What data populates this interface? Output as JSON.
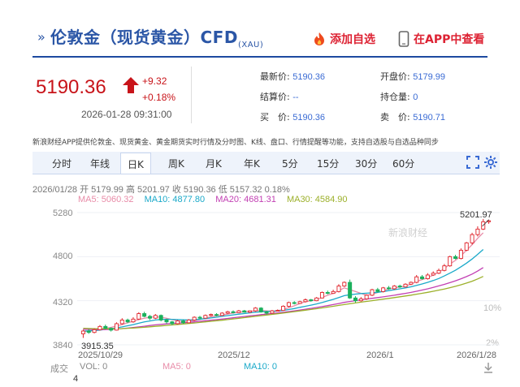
{
  "header": {
    "arrow": "»",
    "title": "伦敦金（现货黄金）CFD",
    "symbol": "(XAU)",
    "add_favorite": "添加自选",
    "view_in_app": "在APP中查看"
  },
  "quote": {
    "price": "5190.36",
    "change": "+9.32",
    "change_pct": "+0.18%",
    "time": "2026-01-28 09:31:00",
    "latest_label": "最新价:",
    "latest_value": "5190.36",
    "open_label": "开盘价:",
    "open_value": "5179.99",
    "settle_label": "结算价:",
    "settle_value": "--",
    "hold_label": "持仓量:",
    "hold_value": "0",
    "buy_label": "买　价:",
    "buy_value": "5190.36",
    "sell_label": "卖　价:",
    "sell_value": "5190.71",
    "up_color": "#c8141a",
    "value_color": "#3a6bd4"
  },
  "note": "新浪财经APP提供伦敦金、现货黄金、黄金期货实时行情及分时图、K线、盘口、行情提醒等功能，支持自选股与自选品种同步",
  "tabs": [
    {
      "label": "分时"
    },
    {
      "label": "年线"
    },
    {
      "label": "日K",
      "active": true
    },
    {
      "label": "周K"
    },
    {
      "label": "月K"
    },
    {
      "label": "年K"
    },
    {
      "label": "5分"
    },
    {
      "label": "15分"
    },
    {
      "label": "30分"
    },
    {
      "label": "60分"
    }
  ],
  "tab_icons": [
    "expand-icon",
    "settings-icon"
  ],
  "chart_info": {
    "line1": "2026/01/28 开 5179.99 高 5201.97 收 5190.36 低 5157.32 0.18%",
    "ma5": "MA5: 5060.32",
    "ma10": "MA10: 4877.80",
    "ma20": "MA20: 4681.31",
    "ma30": "MA30: 4584.90",
    "high_marker": "5201.97",
    "low_marker": "3915.35",
    "watermark": "新浪财经",
    "ma_colors": {
      "ma5": "#e88ca8",
      "ma10": "#1aa9c9",
      "ma20": "#c23fb3",
      "ma30": "#9cb02a"
    },
    "up_color": "#e0242b",
    "down_color": "#1bb05c"
  },
  "y_axis_left": [
    "5280",
    "4800",
    "4320",
    "3840"
  ],
  "y_axis_right": [
    "10%",
    "2%"
  ],
  "x_axis": [
    "2025/10/29",
    "2025/12",
    "2026/1",
    "2026/1/28"
  ],
  "volume": {
    "label": "成交",
    "vol": "VOL: 0",
    "ma5": "MA5: 0",
    "ma10": "MA10: 0",
    "axis": "4"
  },
  "chart_data": {
    "type": "candlestick",
    "x_range": [
      "2025/10/29",
      "2026/1/28"
    ],
    "ylim": [
      3840,
      5280
    ],
    "candles": [
      {
        "o": 3960,
        "c": 3990,
        "h": 4005,
        "l": 3915
      },
      {
        "o": 3990,
        "c": 3975,
        "h": 4010,
        "l": 3960
      },
      {
        "o": 3975,
        "c": 4005,
        "h": 4020,
        "l": 3965
      },
      {
        "o": 4005,
        "c": 4040,
        "h": 4055,
        "l": 3995
      },
      {
        "o": 4040,
        "c": 4020,
        "h": 4060,
        "l": 4010
      },
      {
        "o": 4020,
        "c": 4000,
        "h": 4030,
        "l": 3985
      },
      {
        "o": 4000,
        "c": 4070,
        "h": 4085,
        "l": 3995
      },
      {
        "o": 4070,
        "c": 4110,
        "h": 4130,
        "l": 4060
      },
      {
        "o": 4110,
        "c": 4090,
        "h": 4125,
        "l": 4075
      },
      {
        "o": 4090,
        "c": 4120,
        "h": 4140,
        "l": 4080
      },
      {
        "o": 4120,
        "c": 4180,
        "h": 4195,
        "l": 4110
      },
      {
        "o": 4180,
        "c": 4150,
        "h": 4200,
        "l": 4140
      },
      {
        "o": 4150,
        "c": 4130,
        "h": 4165,
        "l": 4110
      },
      {
        "o": 4130,
        "c": 4160,
        "h": 4175,
        "l": 4120
      },
      {
        "o": 4160,
        "c": 4110,
        "h": 4170,
        "l": 4095
      },
      {
        "o": 4110,
        "c": 4090,
        "h": 4125,
        "l": 4070
      },
      {
        "o": 4090,
        "c": 4070,
        "h": 4100,
        "l": 4055
      },
      {
        "o": 4070,
        "c": 4100,
        "h": 4110,
        "l": 4060
      },
      {
        "o": 4100,
        "c": 4080,
        "h": 4115,
        "l": 4070
      },
      {
        "o": 4080,
        "c": 4110,
        "h": 4120,
        "l": 4075
      },
      {
        "o": 4110,
        "c": 4140,
        "h": 4150,
        "l": 4100
      },
      {
        "o": 4140,
        "c": 4130,
        "h": 4155,
        "l": 4120
      },
      {
        "o": 4130,
        "c": 4160,
        "h": 4170,
        "l": 4125
      },
      {
        "o": 4160,
        "c": 4170,
        "h": 4180,
        "l": 4150
      },
      {
        "o": 4170,
        "c": 4160,
        "h": 4185,
        "l": 4150
      },
      {
        "o": 4160,
        "c": 4185,
        "h": 4195,
        "l": 4155
      },
      {
        "o": 4185,
        "c": 4200,
        "h": 4210,
        "l": 4175
      },
      {
        "o": 4200,
        "c": 4190,
        "h": 4215,
        "l": 4180
      },
      {
        "o": 4190,
        "c": 4210,
        "h": 4220,
        "l": 4185
      },
      {
        "o": 4210,
        "c": 4195,
        "h": 4220,
        "l": 4190
      },
      {
        "o": 4195,
        "c": 4210,
        "h": 4215,
        "l": 4185
      },
      {
        "o": 4210,
        "c": 4240,
        "h": 4250,
        "l": 4200
      },
      {
        "o": 4240,
        "c": 4200,
        "h": 4250,
        "l": 4190
      },
      {
        "o": 4200,
        "c": 4185,
        "h": 4210,
        "l": 4170
      },
      {
        "o": 4185,
        "c": 4210,
        "h": 4220,
        "l": 4180
      },
      {
        "o": 4210,
        "c": 4215,
        "h": 4225,
        "l": 4205
      },
      {
        "o": 4215,
        "c": 4260,
        "h": 4270,
        "l": 4210
      },
      {
        "o": 4260,
        "c": 4300,
        "h": 4310,
        "l": 4250
      },
      {
        "o": 4300,
        "c": 4290,
        "h": 4315,
        "l": 4280
      },
      {
        "o": 4290,
        "c": 4310,
        "h": 4320,
        "l": 4285
      },
      {
        "o": 4310,
        "c": 4330,
        "h": 4345,
        "l": 4300
      },
      {
        "o": 4330,
        "c": 4320,
        "h": 4340,
        "l": 4310
      },
      {
        "o": 4320,
        "c": 4350,
        "h": 4360,
        "l": 4315
      },
      {
        "o": 4350,
        "c": 4410,
        "h": 4420,
        "l": 4345
      },
      {
        "o": 4410,
        "c": 4400,
        "h": 4430,
        "l": 4390
      },
      {
        "o": 4400,
        "c": 4420,
        "h": 4440,
        "l": 4395
      },
      {
        "o": 4420,
        "c": 4480,
        "h": 4500,
        "l": 4410
      },
      {
        "o": 4480,
        "c": 4520,
        "h": 4530,
        "l": 4470
      },
      {
        "o": 4520,
        "c": 4350,
        "h": 4550,
        "l": 4340
      },
      {
        "o": 4350,
        "c": 4320,
        "h": 4370,
        "l": 4300
      },
      {
        "o": 4320,
        "c": 4340,
        "h": 4360,
        "l": 4310
      },
      {
        "o": 4340,
        "c": 4380,
        "h": 4390,
        "l": 4330
      },
      {
        "o": 4380,
        "c": 4440,
        "h": 4450,
        "l": 4370
      },
      {
        "o": 4440,
        "c": 4420,
        "h": 4460,
        "l": 4410
      },
      {
        "o": 4420,
        "c": 4460,
        "h": 4470,
        "l": 4410
      },
      {
        "o": 4460,
        "c": 4450,
        "h": 4480,
        "l": 4440
      },
      {
        "o": 4450,
        "c": 4480,
        "h": 4490,
        "l": 4440
      },
      {
        "o": 4480,
        "c": 4470,
        "h": 4495,
        "l": 4460
      },
      {
        "o": 4470,
        "c": 4500,
        "h": 4510,
        "l": 4465
      },
      {
        "o": 4500,
        "c": 4520,
        "h": 4530,
        "l": 4490
      },
      {
        "o": 4520,
        "c": 4580,
        "h": 4600,
        "l": 4510
      },
      {
        "o": 4580,
        "c": 4560,
        "h": 4600,
        "l": 4550
      },
      {
        "o": 4560,
        "c": 4600,
        "h": 4620,
        "l": 4550
      },
      {
        "o": 4600,
        "c": 4620,
        "h": 4640,
        "l": 4590
      },
      {
        "o": 4620,
        "c": 4650,
        "h": 4670,
        "l": 4610
      },
      {
        "o": 4650,
        "c": 4700,
        "h": 4720,
        "l": 4640
      },
      {
        "o": 4700,
        "c": 4800,
        "h": 4810,
        "l": 4690
      },
      {
        "o": 4800,
        "c": 4780,
        "h": 4820,
        "l": 4770
      },
      {
        "o": 4780,
        "c": 4870,
        "h": 4890,
        "l": 4770
      },
      {
        "o": 4870,
        "c": 4950,
        "h": 4960,
        "l": 4860
      },
      {
        "o": 4950,
        "c": 5040,
        "h": 5060,
        "l": 4930
      },
      {
        "o": 5040,
        "c": 5100,
        "h": 5130,
        "l": 5020
      },
      {
        "o": 5100,
        "c": 5180,
        "h": 5210,
        "l": 5090
      },
      {
        "o": 5180,
        "c": 5190.36,
        "h": 5201.97,
        "l": 5157.32
      }
    ],
    "ma": {
      "ma5": [
        3985,
        3990,
        3998,
        4010,
        4020,
        4030,
        4045,
        4060,
        4080,
        4095,
        4115,
        4130,
        4140,
        4145,
        4140,
        4130,
        4115,
        4100,
        4095,
        4095,
        4105,
        4115,
        4130,
        4145,
        4155,
        4165,
        4175,
        4185,
        4195,
        4200,
        4205,
        4210,
        4215,
        4210,
        4205,
        4210,
        4225,
        4245,
        4265,
        4290,
        4310,
        4320,
        4330,
        4355,
        4380,
        4400,
        4430,
        4460,
        4440,
        4420,
        4400,
        4380,
        4390,
        4410,
        4430,
        4450,
        4460,
        4470,
        4480,
        4500,
        4530,
        4550,
        4570,
        4600,
        4630,
        4670,
        4720,
        4760,
        4810,
        4870,
        4930,
        5000,
        5060
      ],
      "ma10": [
        3990,
        3992,
        3995,
        4000,
        4008,
        4015,
        4025,
        4035,
        4048,
        4060,
        4075,
        4090,
        4100,
        4110,
        4115,
        4118,
        4117,
        4115,
        4112,
        4110,
        4112,
        4118,
        4125,
        4132,
        4140,
        4150,
        4158,
        4166,
        4174,
        4180,
        4188,
        4194,
        4200,
        4203,
        4205,
        4208,
        4215,
        4224,
        4235,
        4248,
        4260,
        4272,
        4285,
        4300,
        4318,
        4335,
        4355,
        4375,
        4385,
        4392,
        4398,
        4402,
        4406,
        4412,
        4420,
        4430,
        4440,
        4450,
        4460,
        4472,
        4487,
        4503,
        4520,
        4540,
        4562,
        4590,
        4620,
        4652,
        4690,
        4730,
        4775,
        4825,
        4878
      ],
      "ma20": [
        4010,
        4008,
        4006,
        4005,
        4006,
        4008,
        4012,
        4017,
        4022,
        4028,
        4035,
        4042,
        4050,
        4057,
        4063,
        4068,
        4072,
        4076,
        4080,
        4085,
        4090,
        4096,
        4102,
        4108,
        4114,
        4120,
        4127,
        4134,
        4141,
        4148,
        4155,
        4162,
        4169,
        4175,
        4181,
        4187,
        4194,
        4202,
        4210,
        4219,
        4228,
        4237,
        4246,
        4256,
        4267,
        4278,
        4290,
        4302,
        4312,
        4321,
        4330,
        4338,
        4346,
        4354,
        4362,
        4371,
        4380,
        4390,
        4400,
        4411,
        4423,
        4436,
        4450,
        4465,
        4481,
        4498,
        4517,
        4537,
        4559,
        4583,
        4610,
        4643,
        4681
      ],
      "ma30": [
        4020,
        4018,
        4016,
        4015,
        4014,
        4014,
        4015,
        4017,
        4020,
        4023,
        4027,
        4031,
        4036,
        4041,
        4046,
        4051,
        4056,
        4061,
        4066,
        4072,
        4078,
        4084,
        4090,
        4096,
        4102,
        4108,
        4115,
        4122,
        4129,
        4136,
        4143,
        4150,
        4157,
        4164,
        4171,
        4178,
        4185,
        4193,
        4201,
        4209,
        4217,
        4225,
        4233,
        4242,
        4251,
        4260,
        4269,
        4278,
        4287,
        4296,
        4305,
        4313,
        4321,
        4329,
        4337,
        4345,
        4354,
        4363,
        4372,
        4381,
        4391,
        4401,
        4412,
        4423,
        4435,
        4448,
        4462,
        4477,
        4494,
        4512,
        4533,
        4557,
        4585
      ]
    }
  }
}
